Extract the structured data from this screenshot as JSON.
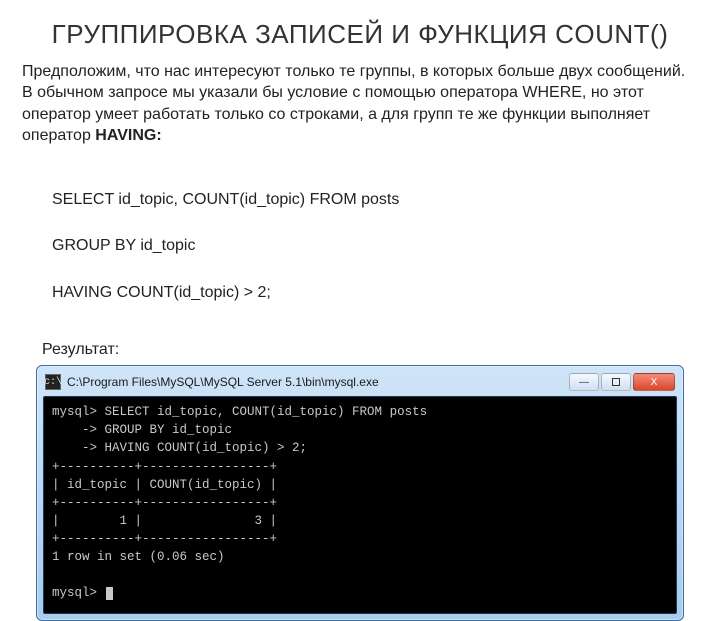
{
  "title": "ГРУППИРОВКА ЗАПИСЕЙ И ФУНКЦИЯ COUNT()",
  "paragraph": {
    "text_before_bold": "Предположим, что нас интересуют только те группы, в которых больше двух сообщений. В обычном запросе мы указали бы условие с помощью оператора WHERE, но этот оператор умеет работать только со строками, а для групп те же функции выполняет оператор ",
    "bold": "HAVING:"
  },
  "sql": {
    "line1": "SELECT id_topic, COUNT(id_topic) FROM posts",
    "line2": "GROUP BY id_topic",
    "line3": "HAVING COUNT(id_topic) > 2;"
  },
  "result_label": "Результат:",
  "window": {
    "icon_glyph": "c:\\",
    "title_path": "C:\\Program Files\\MySQL\\MySQL Server 5.1\\bin\\mysql.exe",
    "btn_min": "—",
    "btn_close": "X"
  },
  "terminal": {
    "prompt": "mysql>",
    "cont": "    ->",
    "q1": " SELECT id_topic, COUNT(id_topic) FROM posts",
    "q2": " GROUP BY id_topic",
    "q3": " HAVING COUNT(id_topic) > 2;",
    "sep": "+----------+-----------------+",
    "hdr": "| id_topic | COUNT(id_topic) |",
    "row": "|        1 |               3 |",
    "foot": "1 row in set (0.06 sec)"
  }
}
